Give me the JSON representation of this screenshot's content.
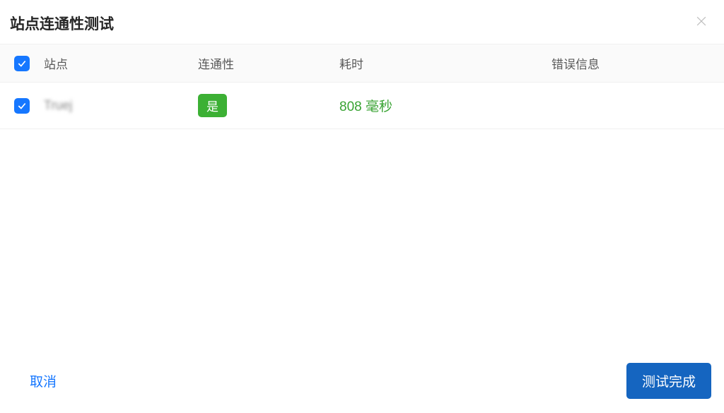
{
  "modal": {
    "title": "站点连通性测试"
  },
  "table": {
    "headers": {
      "site": "站点",
      "connectivity": "连通性",
      "time": "耗时",
      "error": "错误信息"
    },
    "rows": [
      {
        "checked": true,
        "site": "Truej",
        "connectivity": "是",
        "time": "808 毫秒",
        "error": ""
      }
    ]
  },
  "footer": {
    "cancel": "取消",
    "confirm": "测试完成"
  }
}
